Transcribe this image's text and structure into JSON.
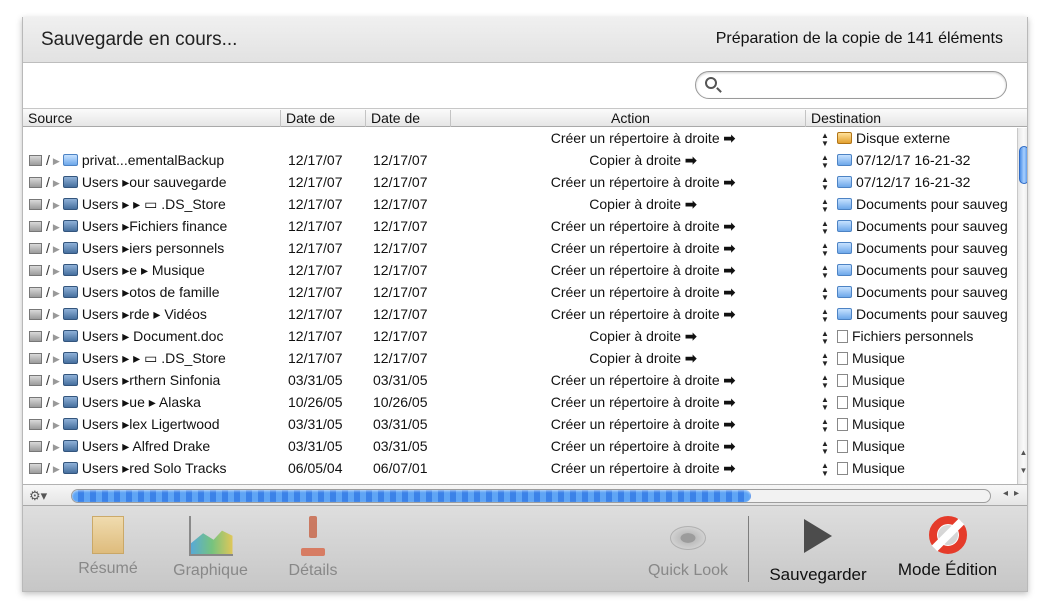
{
  "header": {
    "status": "Sauvegarde en cours...",
    "preparation": "Préparation de la copie de 141 éléments"
  },
  "search": {
    "value": ""
  },
  "columns": {
    "source": "Source",
    "date1": "Date de",
    "date2": "Date de",
    "action": "Action",
    "destination": "Destination"
  },
  "rows": [
    {
      "src_icon": "",
      "src": "",
      "d1": "",
      "d2": "",
      "action": "Créer un répertoire à droite",
      "dst_icon": "hdd",
      "dst": "Disque externe"
    },
    {
      "src_icon": "folder",
      "src": "privat...ementalBackup",
      "d1": "12/17/07",
      "d2": "12/17/07",
      "action": "Copier à droite",
      "dst_icon": "folder",
      "dst": "07/12/17 16-21-32"
    },
    {
      "src_icon": "users",
      "src": "Users ▸our sauvegarde",
      "d1": "12/17/07",
      "d2": "12/17/07",
      "action": "Créer un répertoire à droite",
      "dst_icon": "folder",
      "dst": "07/12/17 16-21-32"
    },
    {
      "src_icon": "users",
      "src": "Users ▸ ▸ ▭ .DS_Store",
      "d1": "12/17/07",
      "d2": "12/17/07",
      "action": "Copier à droite",
      "dst_icon": "folder",
      "dst": "Documents pour sauveg"
    },
    {
      "src_icon": "users",
      "src": "Users ▸Fichiers finance",
      "d1": "12/17/07",
      "d2": "12/17/07",
      "action": "Créer un répertoire à droite",
      "dst_icon": "folder",
      "dst": "Documents pour sauveg"
    },
    {
      "src_icon": "users",
      "src": "Users ▸iers personnels",
      "d1": "12/17/07",
      "d2": "12/17/07",
      "action": "Créer un répertoire à droite",
      "dst_icon": "folder",
      "dst": "Documents pour sauveg"
    },
    {
      "src_icon": "users",
      "src": "Users ▸e ▸ Musique",
      "d1": "12/17/07",
      "d2": "12/17/07",
      "action": "Créer un répertoire à droite",
      "dst_icon": "folder",
      "dst": "Documents pour sauveg"
    },
    {
      "src_icon": "users",
      "src": "Users ▸otos de famille",
      "d1": "12/17/07",
      "d2": "12/17/07",
      "action": "Créer un répertoire à droite",
      "dst_icon": "folder",
      "dst": "Documents pour sauveg"
    },
    {
      "src_icon": "users",
      "src": "Users ▸rde ▸ Vidéos",
      "d1": "12/17/07",
      "d2": "12/17/07",
      "action": "Créer un répertoire à droite",
      "dst_icon": "folder",
      "dst": "Documents pour sauveg"
    },
    {
      "src_icon": "users",
      "src": "Users ▸ Document.doc",
      "d1": "12/17/07",
      "d2": "12/17/07",
      "action": "Copier à droite",
      "dst_icon": "doc",
      "dst": "Fichiers personnels"
    },
    {
      "src_icon": "users",
      "src": "Users ▸ ▸ ▭ .DS_Store",
      "d1": "12/17/07",
      "d2": "12/17/07",
      "action": "Copier à droite",
      "dst_icon": "doc",
      "dst": "Musique"
    },
    {
      "src_icon": "users",
      "src": "Users ▸rthern Sinfonia",
      "d1": "03/31/05",
      "d2": "03/31/05",
      "action": "Créer un répertoire à droite",
      "dst_icon": "doc",
      "dst": "Musique"
    },
    {
      "src_icon": "users",
      "src": "Users ▸ue ▸ Alaska",
      "d1": "10/26/05",
      "d2": "10/26/05",
      "action": "Créer un répertoire à droite",
      "dst_icon": "doc",
      "dst": "Musique"
    },
    {
      "src_icon": "users",
      "src": "Users ▸lex Ligertwood",
      "d1": "03/31/05",
      "d2": "03/31/05",
      "action": "Créer un répertoire à droite",
      "dst_icon": "doc",
      "dst": "Musique"
    },
    {
      "src_icon": "users",
      "src": "Users ▸ Alfred Drake",
      "d1": "03/31/05",
      "d2": "03/31/05",
      "action": "Créer un répertoire à droite",
      "dst_icon": "doc",
      "dst": "Musique"
    },
    {
      "src_icon": "users",
      "src": "Users ▸red Solo Tracks",
      "d1": "06/05/04",
      "d2": "06/07/01",
      "action": "Créer un répertoire à droite",
      "dst_icon": "doc",
      "dst": "Musique"
    }
  ],
  "progress": {
    "fraction": 0.74
  },
  "toolbar": {
    "resume": "Résumé",
    "graphique": "Graphique",
    "details": "Détails",
    "quicklook": "Quick Look",
    "sauvegarder": "Sauvegarder",
    "mode_edition": "Mode Édition"
  }
}
